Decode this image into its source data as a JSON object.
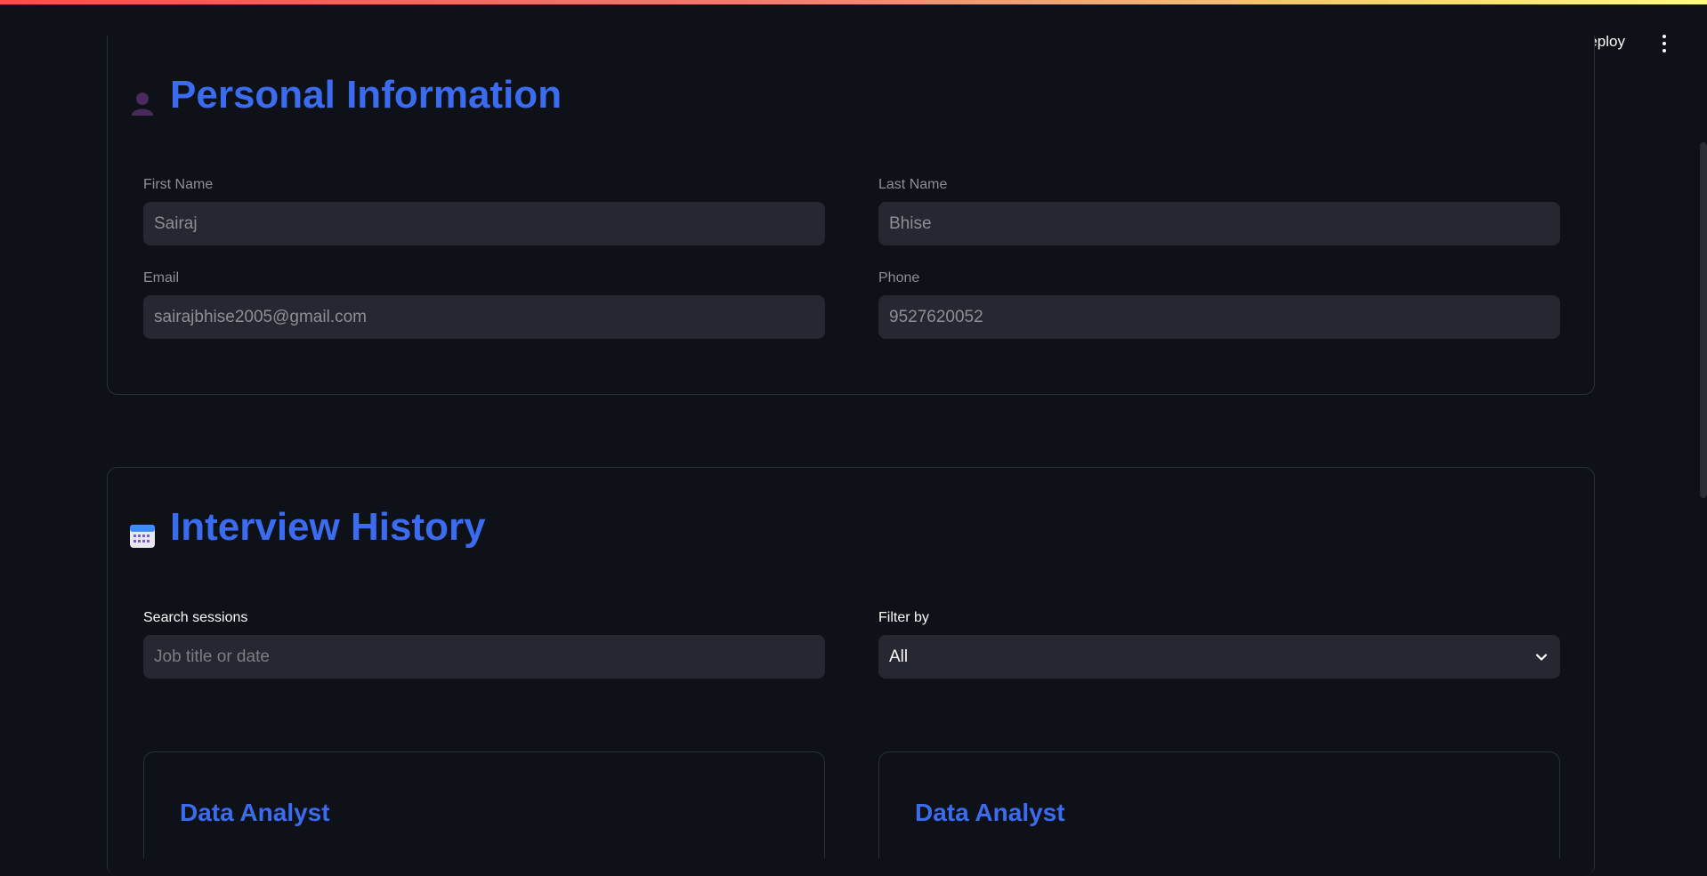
{
  "topbar": {
    "deploy_label": "Deploy"
  },
  "personal": {
    "title": "Personal Information",
    "icon": "person-silhouette-icon",
    "first_name": {
      "label": "First Name",
      "value": "Sairaj"
    },
    "last_name": {
      "label": "Last Name",
      "value": "Bhise"
    },
    "email": {
      "label": "Email",
      "value": "sairajbhise2005@gmail.com"
    },
    "phone": {
      "label": "Phone",
      "value": "9527620052"
    }
  },
  "history": {
    "title": "Interview History",
    "icon": "calendar-icon",
    "search": {
      "label": "Search sessions",
      "placeholder": "Job title or date"
    },
    "filter": {
      "label": "Filter by",
      "value": "All"
    },
    "sessions": [
      {
        "title": "Data Analyst"
      },
      {
        "title": "Data Analyst"
      }
    ]
  },
  "colors": {
    "background": "#0e1117",
    "accent": "#3b6cf0",
    "input_bg": "#262730"
  }
}
